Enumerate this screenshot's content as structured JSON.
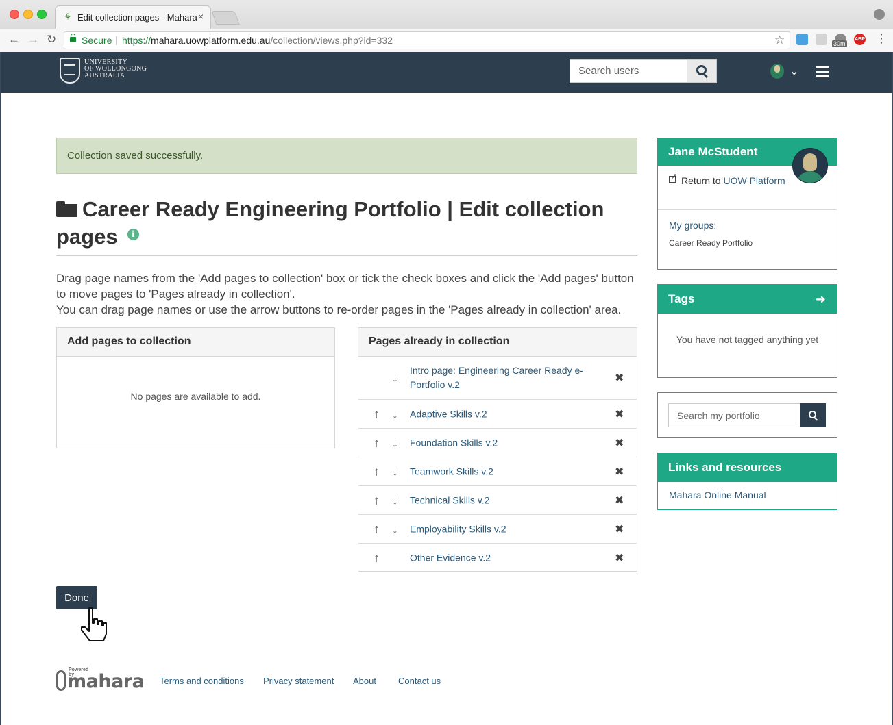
{
  "browser": {
    "tab_title": "Edit collection pages - Mahara",
    "tab_close": "×",
    "secure_label": "Secure",
    "url_scheme": "https://",
    "url_host": "mahara.uowplatform.edu.au",
    "url_path": "/collection/views.php?id=332",
    "extension_badge": "30m",
    "extension_abp": "ABP"
  },
  "header": {
    "university_lines": [
      "UNIVERSITY",
      "OF WOLLONGONG",
      "AUSTRALIA"
    ],
    "search_placeholder": "Search users"
  },
  "alert": {
    "message": "Collection saved successfully."
  },
  "page": {
    "title": "Career Ready Engineering Portfolio | Edit collection pages",
    "instructions_line1": "Drag page names from the 'Add pages to collection' box or tick the check boxes and click the 'Add pages' button to move pages to 'Pages already in collection'.",
    "instructions_line2": "You can drag page names or use the arrow buttons to re-order pages in the 'Pages already in collection' area."
  },
  "add_panel": {
    "heading": "Add pages to collection",
    "empty_message": "No pages are available to add."
  },
  "collection_panel": {
    "heading": "Pages already in collection",
    "pages": [
      {
        "title": "Intro page: Engineering Career Ready e-Portfolio v.2",
        "can_move_up": false,
        "can_move_down": true
      },
      {
        "title": "Adaptive Skills v.2",
        "can_move_up": true,
        "can_move_down": true
      },
      {
        "title": "Foundation Skills v.2",
        "can_move_up": true,
        "can_move_down": true
      },
      {
        "title": "Teamwork Skills v.2",
        "can_move_up": true,
        "can_move_down": true
      },
      {
        "title": "Technical Skills v.2",
        "can_move_up": true,
        "can_move_down": true
      },
      {
        "title": "Employability Skills v.2",
        "can_move_up": true,
        "can_move_down": true
      },
      {
        "title": "Other Evidence v.2",
        "can_move_up": true,
        "can_move_down": false
      }
    ]
  },
  "done_label": "Done",
  "sidebar": {
    "user_name": "Jane McStudent",
    "return_text": "Return to ",
    "return_link": "UOW Platform",
    "groups_label": "My groups:",
    "groups": [
      "Career Ready Portfolio"
    ],
    "tags_heading": "Tags",
    "tags_empty": "You have not tagged anything yet",
    "portfolio_search_placeholder": "Search my portfolio",
    "links_heading": "Links and resources",
    "manual_link": "Mahara Online Manual"
  },
  "footer": {
    "powered_by": "Powered by",
    "brand": "mahara",
    "links": [
      "Terms and conditions",
      "Privacy statement",
      "About",
      "Contact us"
    ]
  },
  "colors": {
    "header_bg": "#2d3e4f",
    "accent_green": "#1ea885",
    "link": "#2b5a7a",
    "alert_bg": "#d4e0c8"
  },
  "icons": {
    "folder": "folder-open-icon",
    "info": "info-icon",
    "up": "arrow-up-icon",
    "down": "arrow-down-icon",
    "remove": "close-icon",
    "search": "search-icon",
    "tags": "arrow-right-icon"
  }
}
